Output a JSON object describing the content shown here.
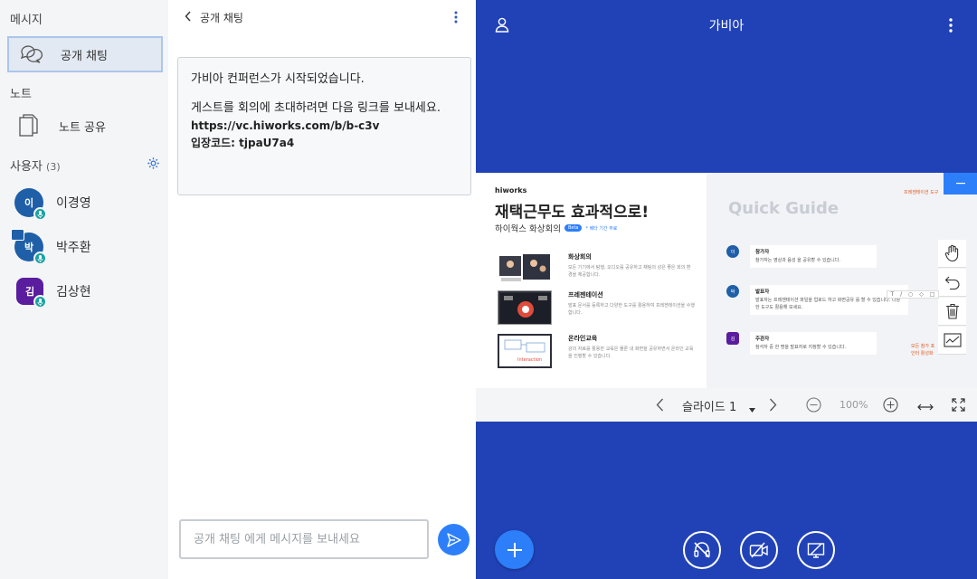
{
  "sidebar": {
    "messages_title": "메시지",
    "public_chat": "공개 채팅",
    "notes_title": "노트",
    "note_share": "노트 공유",
    "users_title": "사용자",
    "users_count": "(3)",
    "users": [
      {
        "initial": "이",
        "name": "이경영",
        "color": "#1f5fa8"
      },
      {
        "initial": "박",
        "name": "박주환",
        "color": "#1f5fa8"
      },
      {
        "initial": "김",
        "name": "김상현",
        "color": "#5a1d9e"
      }
    ]
  },
  "chat": {
    "title": "공개 채팅",
    "message_line1": "가비아 컨퍼런스가 시작되었습니다.",
    "message_line2": "게스트를 회의에 초대하려면 다음 링크를 보내세요.",
    "link": "https://vc.hiworks.com/b/b-c3v",
    "code": "입장코드: tjpaU7a4",
    "input_placeholder": "공개 채팅 에게 메시지를 보내세요"
  },
  "stage": {
    "title": "가비아",
    "slide": {
      "brand": "hiworks",
      "headline": "재택근무도 효과적으로!",
      "subtitle": "하이웍스 화상회의",
      "beta": "Beta",
      "beta_note": "* 베타 기간 무료",
      "features": [
        {
          "title": "화상회의",
          "desc": "모든 기기에서 탐행, 오디오를 공유하고 채팅의 성은 좋은 회의 환경을 제공합니다."
        },
        {
          "title": "프레젠테이션",
          "desc": "발표 문서를 등록하고 다양한 도구를 활용하여 프레젠테이션을 수행합니다."
        },
        {
          "title": "온라인교육",
          "desc": "강의 자료를 활용한 교육은 물론 내 화면을 공유하면서 온라인 교육을 진행할 수 있습니다."
        }
      ],
      "quick_guide": "Quick Guide",
      "presenter_note": "프레젠테이션 도구",
      "all_note": "모든 참가 포인터 활성화",
      "guides": [
        {
          "initial": "이",
          "title": "참가자",
          "desc": "참가자는 영상과 음성 을 공유할 수 있습니다."
        },
        {
          "initial": "박",
          "title": "발표자",
          "desc": "발표자는 프레젠테이션 파일을 업로드 하고 화면공유 를 할 수 있습니다. 다양한 도구도 활용해 보세요."
        },
        {
          "initial": "김",
          "title": "주관자",
          "desc": "참석자 중 한 명을 발표자로 지정할 수 있습니다."
        }
      ]
    },
    "slide_label": "슬라이드 1",
    "zoom": "100%"
  },
  "colors": {
    "stage_bg": "#2142b7",
    "accent": "#2d7ff9",
    "sidebar_bg": "#f4f5f7"
  }
}
